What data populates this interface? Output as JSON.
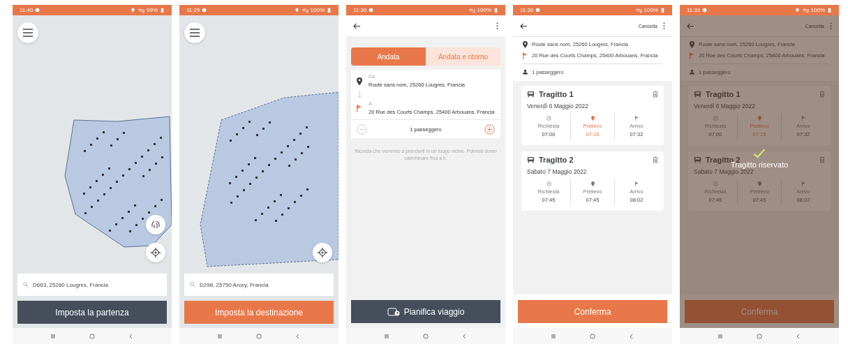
{
  "screens": [
    {
      "kind": "map",
      "status": {
        "time": "11:40",
        "battery": "99%",
        "location": true
      },
      "layers_button": true,
      "search": {
        "value": "D663, 25260 Lougres, Francia"
      },
      "button": {
        "label": "Imposta la partenza",
        "kind": "dark"
      }
    },
    {
      "kind": "map",
      "status": {
        "time": "11:29",
        "battery": "100%",
        "location": true
      },
      "layers_button": false,
      "search": {
        "value": "D298, 25750 Arcey, Francia"
      },
      "button": {
        "label": "Imposta la destinazione",
        "kind": "accent"
      }
    },
    {
      "kind": "plan",
      "status": {
        "time": "11:30",
        "battery": "100%",
        "location": false
      },
      "tabs": [
        {
          "label": "Andata",
          "selected": true
        },
        {
          "label": "Andata e ritorno",
          "selected": false
        }
      ],
      "from_label": "Da",
      "from": "Route sans nom, 25260 Lougres, Francia",
      "to_label": "A",
      "to": "20 Rue des Courts Champs, 25400 Arbouans, Francia",
      "passengers": "1 passeggero",
      "note": "Ricorda che verremo a prenderti in un luogo vicino. Potresti dover camminare fino a lì.",
      "button": {
        "label": "Pianifica viaggio",
        "kind": "dark"
      }
    },
    {
      "kind": "summary",
      "status": {
        "time": "11:30",
        "battery": "100%",
        "location": false
      },
      "cancel": "Cancella",
      "from": "Route sans nom, 25260 Lougres, Francia",
      "to": "20 Rue des Courts Champs, 25400 Arbouans, Francia",
      "passengers": "1 passeggero",
      "trips": [
        {
          "title": "Tragitto 1",
          "date": "Venerdì 6 Maggio 2022",
          "times": [
            {
              "label": "Richiesta",
              "value": "07:00",
              "selected": false
            },
            {
              "label": "Prelievo",
              "value": "07:15",
              "selected": true
            },
            {
              "label": "Arrivo",
              "value": "07:32",
              "selected": false
            }
          ]
        },
        {
          "title": "Tragitto 2",
          "date": "Sabato 7 Maggio 2022",
          "times": [
            {
              "label": "Richiesta",
              "value": "07:45",
              "selected": false
            },
            {
              "label": "Prelievo",
              "value": "07:45",
              "selected": false
            },
            {
              "label": "Arrivo",
              "value": "08:02",
              "selected": false
            }
          ]
        }
      ],
      "button": {
        "label": "Conferma",
        "kind": "accent"
      }
    },
    {
      "kind": "summary",
      "status": {
        "time": "11:31",
        "battery": "100%",
        "location": true
      },
      "cancel": "Cancella",
      "from": "Route sans nom, 25260 Lougres, Francia",
      "to": "20 Rue des Courts Champs, 25400 Arbouans, Francia",
      "passengers": "1 passeggero",
      "trips": [
        {
          "title": "Tragitto 1",
          "date": "Venerdì 6 Maggio 2022",
          "times": [
            {
              "label": "Richiesta",
              "value": "07:00",
              "selected": false
            },
            {
              "label": "Prelievo",
              "value": "07:15",
              "selected": true
            },
            {
              "label": "Arrivo",
              "value": "07:32",
              "selected": false
            }
          ]
        },
        {
          "title": "Tragitto 2",
          "date": "Sabato 7 Maggio 2022",
          "times": [
            {
              "label": "Richiesta",
              "value": "07:45",
              "selected": false
            },
            {
              "label": "Prelievo",
              "value": "07:45",
              "selected": false
            },
            {
              "label": "Arrivo",
              "value": "08:02",
              "selected": false
            }
          ]
        }
      ],
      "button": {
        "label": "Conferma",
        "kind": "accent"
      },
      "confirmation": "Tragitto riservato"
    }
  ]
}
